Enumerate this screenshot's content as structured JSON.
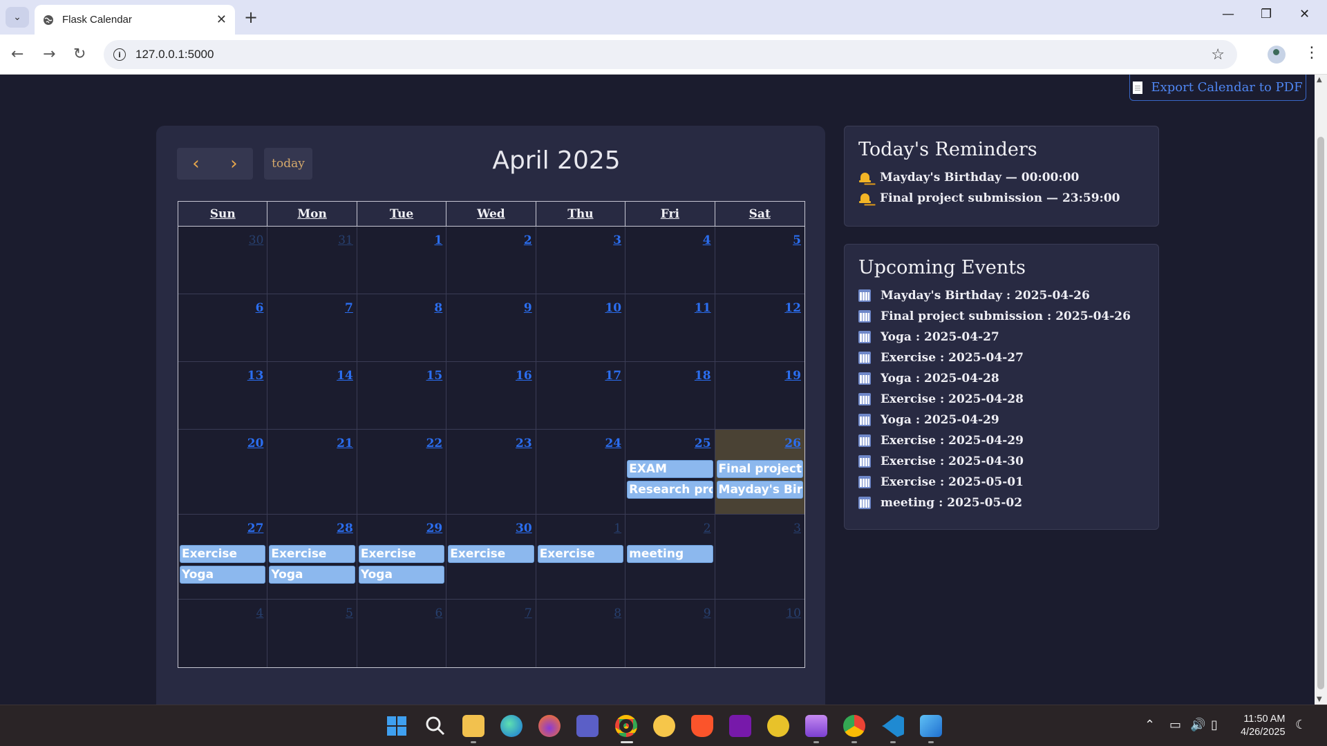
{
  "browser": {
    "tab_title": "Flask Calendar",
    "url": "127.0.0.1:5000"
  },
  "page": {
    "export_label": "Export Calendar to PDF"
  },
  "calendar": {
    "title": "April 2025",
    "today_label": "today",
    "weekdays": [
      "Sun",
      "Mon",
      "Tue",
      "Wed",
      "Thu",
      "Fri",
      "Sat"
    ],
    "weeks": [
      [
        {
          "n": "30",
          "other": true
        },
        {
          "n": "31",
          "other": true
        },
        {
          "n": "1"
        },
        {
          "n": "2"
        },
        {
          "n": "3"
        },
        {
          "n": "4"
        },
        {
          "n": "5"
        }
      ],
      [
        {
          "n": "6"
        },
        {
          "n": "7"
        },
        {
          "n": "8"
        },
        {
          "n": "9"
        },
        {
          "n": "10"
        },
        {
          "n": "11"
        },
        {
          "n": "12"
        }
      ],
      [
        {
          "n": "13"
        },
        {
          "n": "14"
        },
        {
          "n": "15"
        },
        {
          "n": "16"
        },
        {
          "n": "17"
        },
        {
          "n": "18"
        },
        {
          "n": "19"
        }
      ],
      [
        {
          "n": "20"
        },
        {
          "n": "21"
        },
        {
          "n": "22"
        },
        {
          "n": "23"
        },
        {
          "n": "24"
        },
        {
          "n": "25",
          "events": [
            "EXAM",
            "Research proj"
          ]
        },
        {
          "n": "26",
          "today": true,
          "events": [
            "Final project s",
            "Mayday's Birth"
          ]
        }
      ],
      [
        {
          "n": "27",
          "events": [
            "Exercise",
            "Yoga"
          ]
        },
        {
          "n": "28",
          "events": [
            "Exercise",
            "Yoga"
          ]
        },
        {
          "n": "29",
          "events": [
            "Exercise",
            "Yoga"
          ]
        },
        {
          "n": "30",
          "events": [
            "Exercise"
          ]
        },
        {
          "n": "1",
          "other": true,
          "events": [
            "Exercise"
          ]
        },
        {
          "n": "2",
          "other": true,
          "events": [
            "meeting"
          ]
        },
        {
          "n": "3",
          "other": true
        }
      ],
      [
        {
          "n": "4",
          "other": true
        },
        {
          "n": "5",
          "other": true
        },
        {
          "n": "6",
          "other": true
        },
        {
          "n": "7",
          "other": true
        },
        {
          "n": "8",
          "other": true
        },
        {
          "n": "9",
          "other": true
        },
        {
          "n": "10",
          "other": true
        }
      ]
    ]
  },
  "reminders": {
    "heading": "Today's Reminders",
    "items": [
      "Mayday's Birthday — 00:00:00",
      "Final project submission — 23:59:00"
    ]
  },
  "upcoming": {
    "heading": "Upcoming Events",
    "items": [
      "Mayday's Birthday : 2025-04-26",
      "Final project submission : 2025-04-26",
      "Yoga : 2025-04-27",
      "Exercise : 2025-04-27",
      "Yoga : 2025-04-28",
      "Exercise : 2025-04-28",
      "Yoga : 2025-04-29",
      "Exercise : 2025-04-29",
      "Exercise : 2025-04-30",
      "Exercise : 2025-05-01",
      "meeting : 2025-05-02"
    ]
  },
  "taskbar": {
    "time": "11:50 AM",
    "date": "4/26/2025",
    "apps": [
      "start-icon",
      "search-icon",
      "file-explorer-icon",
      "edge-icon",
      "firefox-icon",
      "teams-icon",
      "chrome-icon",
      "emoji-app-icon",
      "brave-icon",
      "onenote-icon",
      "app-icon",
      "video-editor-icon",
      "chrome-profile-icon",
      "vscode-icon",
      "photos-icon"
    ]
  },
  "colors": {
    "page_bg": "#1b1c2e",
    "panel_bg": "#282a42",
    "accent_link": "#2b6ef0",
    "event_bg": "#8cb8ee",
    "nav_arrow": "#e7a74c",
    "today_cell": "#4a4234"
  }
}
